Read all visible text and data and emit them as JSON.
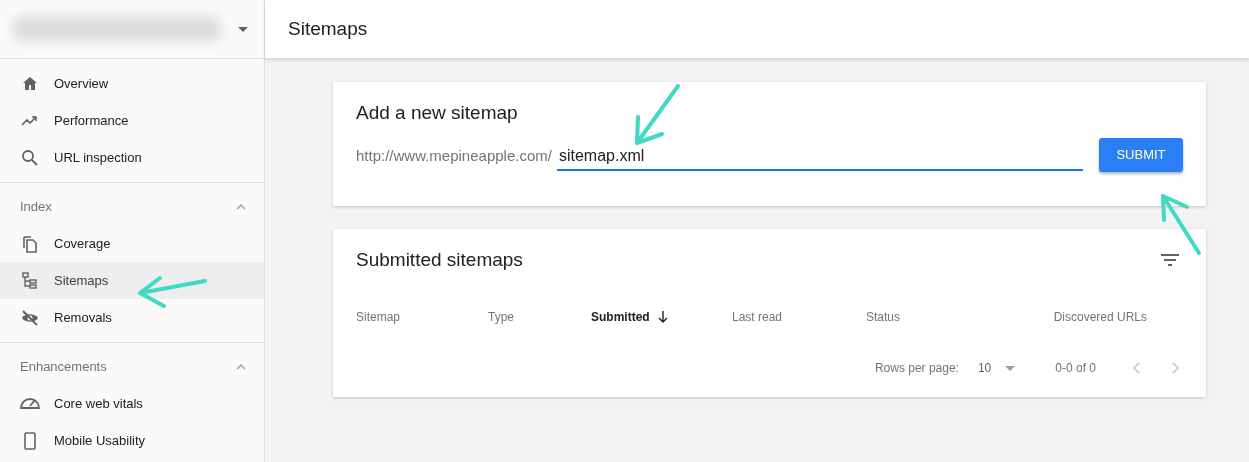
{
  "sidebar": {
    "groups": [
      {
        "items": [
          {
            "label": "Overview",
            "selected": false
          },
          {
            "label": "Performance",
            "selected": false
          },
          {
            "label": "URL inspection",
            "selected": false
          }
        ]
      },
      {
        "heading": "Index",
        "expanded": true,
        "items": [
          {
            "label": "Coverage",
            "selected": false
          },
          {
            "label": "Sitemaps",
            "selected": true
          },
          {
            "label": "Removals",
            "selected": false
          }
        ]
      },
      {
        "heading": "Enhancements",
        "expanded": true,
        "items": [
          {
            "label": "Core web vitals",
            "selected": false
          },
          {
            "label": "Mobile Usability",
            "selected": false
          }
        ]
      }
    ]
  },
  "header": {
    "title": "Sitemaps"
  },
  "add_sitemap": {
    "title": "Add a new sitemap",
    "url_prefix": "http://www.mepineapple.com/",
    "value": "sitemap.xml",
    "button": "SUBMIT"
  },
  "submitted_sitemaps": {
    "title": "Submitted sitemaps",
    "columns": [
      {
        "label": "Sitemap",
        "sorted": false
      },
      {
        "label": "Type",
        "sorted": false
      },
      {
        "label": "Submitted",
        "sorted": true
      },
      {
        "label": "Last read",
        "sorted": false
      },
      {
        "label": "Status",
        "sorted": false
      },
      {
        "label": "Discovered URLs",
        "sorted": false
      }
    ],
    "pagination": {
      "rows_label": "Rows per page:",
      "rows_value": "10",
      "range": "0-0 of 0"
    }
  },
  "annotations": [
    {
      "kind": "arrow"
    },
    {
      "kind": "arrow"
    },
    {
      "kind": "arrow"
    }
  ]
}
